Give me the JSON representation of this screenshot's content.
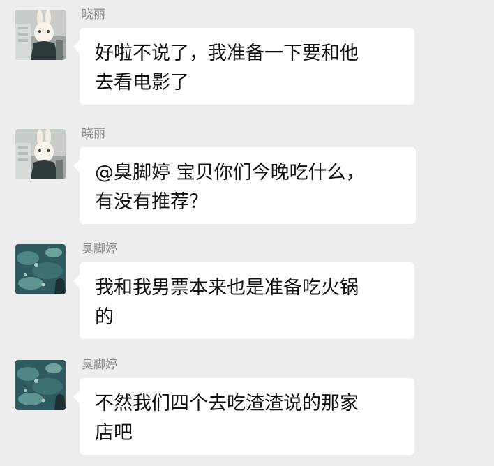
{
  "messages": [
    {
      "sender": "晓丽",
      "avatar": "bunny-avatar-icon",
      "lines": [
        "好啦不说了，我准备一下要和他",
        "去看电影了"
      ]
    },
    {
      "sender": "晓丽",
      "avatar": "bunny-avatar-icon",
      "lines": [
        "@臭脚婷 宝贝你们今晚吃什么，",
        "有没有推荐？"
      ]
    },
    {
      "sender": "臭脚婷",
      "avatar": "ocean-avatar-icon",
      "lines": [
        "我和我男票本来也是准备吃火锅",
        "的"
      ]
    },
    {
      "sender": "臭脚婷",
      "avatar": "ocean-avatar-icon",
      "lines": [
        "不然我们四个去吃渣渣说的那家",
        "店吧"
      ]
    }
  ],
  "colors": {
    "background": "#ededed",
    "bubble": "#ffffff",
    "sender_name": "#8a8a8a",
    "message_text": "#111111"
  }
}
